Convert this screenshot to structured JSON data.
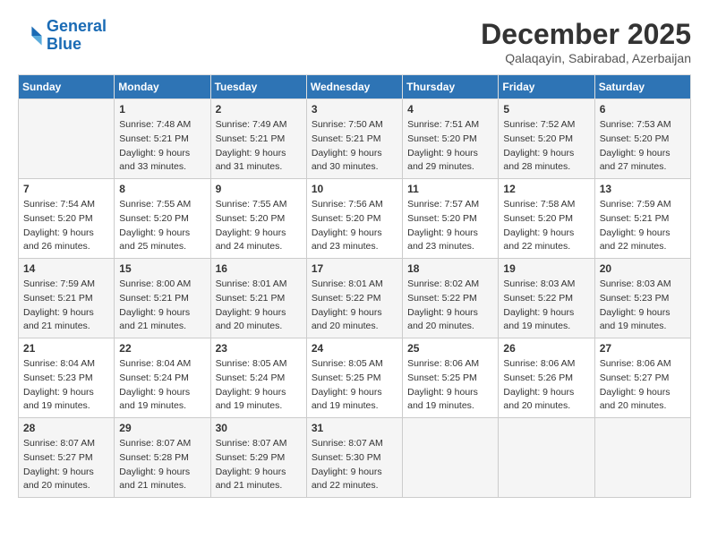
{
  "logo": {
    "line1": "General",
    "line2": "Blue"
  },
  "title": "December 2025",
  "subtitle": "Qalaqayin, Sabirabad, Azerbaijan",
  "weekdays": [
    "Sunday",
    "Monday",
    "Tuesday",
    "Wednesday",
    "Thursday",
    "Friday",
    "Saturday"
  ],
  "weeks": [
    [
      {
        "day": "",
        "sunrise": "",
        "sunset": "",
        "daylight": ""
      },
      {
        "day": "1",
        "sunrise": "Sunrise: 7:48 AM",
        "sunset": "Sunset: 5:21 PM",
        "daylight": "Daylight: 9 hours and 33 minutes."
      },
      {
        "day": "2",
        "sunrise": "Sunrise: 7:49 AM",
        "sunset": "Sunset: 5:21 PM",
        "daylight": "Daylight: 9 hours and 31 minutes."
      },
      {
        "day": "3",
        "sunrise": "Sunrise: 7:50 AM",
        "sunset": "Sunset: 5:21 PM",
        "daylight": "Daylight: 9 hours and 30 minutes."
      },
      {
        "day": "4",
        "sunrise": "Sunrise: 7:51 AM",
        "sunset": "Sunset: 5:20 PM",
        "daylight": "Daylight: 9 hours and 29 minutes."
      },
      {
        "day": "5",
        "sunrise": "Sunrise: 7:52 AM",
        "sunset": "Sunset: 5:20 PM",
        "daylight": "Daylight: 9 hours and 28 minutes."
      },
      {
        "day": "6",
        "sunrise": "Sunrise: 7:53 AM",
        "sunset": "Sunset: 5:20 PM",
        "daylight": "Daylight: 9 hours and 27 minutes."
      }
    ],
    [
      {
        "day": "7",
        "sunrise": "Sunrise: 7:54 AM",
        "sunset": "Sunset: 5:20 PM",
        "daylight": "Daylight: 9 hours and 26 minutes."
      },
      {
        "day": "8",
        "sunrise": "Sunrise: 7:55 AM",
        "sunset": "Sunset: 5:20 PM",
        "daylight": "Daylight: 9 hours and 25 minutes."
      },
      {
        "day": "9",
        "sunrise": "Sunrise: 7:55 AM",
        "sunset": "Sunset: 5:20 PM",
        "daylight": "Daylight: 9 hours and 24 minutes."
      },
      {
        "day": "10",
        "sunrise": "Sunrise: 7:56 AM",
        "sunset": "Sunset: 5:20 PM",
        "daylight": "Daylight: 9 hours and 23 minutes."
      },
      {
        "day": "11",
        "sunrise": "Sunrise: 7:57 AM",
        "sunset": "Sunset: 5:20 PM",
        "daylight": "Daylight: 9 hours and 23 minutes."
      },
      {
        "day": "12",
        "sunrise": "Sunrise: 7:58 AM",
        "sunset": "Sunset: 5:20 PM",
        "daylight": "Daylight: 9 hours and 22 minutes."
      },
      {
        "day": "13",
        "sunrise": "Sunrise: 7:59 AM",
        "sunset": "Sunset: 5:21 PM",
        "daylight": "Daylight: 9 hours and 22 minutes."
      }
    ],
    [
      {
        "day": "14",
        "sunrise": "Sunrise: 7:59 AM",
        "sunset": "Sunset: 5:21 PM",
        "daylight": "Daylight: 9 hours and 21 minutes."
      },
      {
        "day": "15",
        "sunrise": "Sunrise: 8:00 AM",
        "sunset": "Sunset: 5:21 PM",
        "daylight": "Daylight: 9 hours and 21 minutes."
      },
      {
        "day": "16",
        "sunrise": "Sunrise: 8:01 AM",
        "sunset": "Sunset: 5:21 PM",
        "daylight": "Daylight: 9 hours and 20 minutes."
      },
      {
        "day": "17",
        "sunrise": "Sunrise: 8:01 AM",
        "sunset": "Sunset: 5:22 PM",
        "daylight": "Daylight: 9 hours and 20 minutes."
      },
      {
        "day": "18",
        "sunrise": "Sunrise: 8:02 AM",
        "sunset": "Sunset: 5:22 PM",
        "daylight": "Daylight: 9 hours and 20 minutes."
      },
      {
        "day": "19",
        "sunrise": "Sunrise: 8:03 AM",
        "sunset": "Sunset: 5:22 PM",
        "daylight": "Daylight: 9 hours and 19 minutes."
      },
      {
        "day": "20",
        "sunrise": "Sunrise: 8:03 AM",
        "sunset": "Sunset: 5:23 PM",
        "daylight": "Daylight: 9 hours and 19 minutes."
      }
    ],
    [
      {
        "day": "21",
        "sunrise": "Sunrise: 8:04 AM",
        "sunset": "Sunset: 5:23 PM",
        "daylight": "Daylight: 9 hours and 19 minutes."
      },
      {
        "day": "22",
        "sunrise": "Sunrise: 8:04 AM",
        "sunset": "Sunset: 5:24 PM",
        "daylight": "Daylight: 9 hours and 19 minutes."
      },
      {
        "day": "23",
        "sunrise": "Sunrise: 8:05 AM",
        "sunset": "Sunset: 5:24 PM",
        "daylight": "Daylight: 9 hours and 19 minutes."
      },
      {
        "day": "24",
        "sunrise": "Sunrise: 8:05 AM",
        "sunset": "Sunset: 5:25 PM",
        "daylight": "Daylight: 9 hours and 19 minutes."
      },
      {
        "day": "25",
        "sunrise": "Sunrise: 8:06 AM",
        "sunset": "Sunset: 5:25 PM",
        "daylight": "Daylight: 9 hours and 19 minutes."
      },
      {
        "day": "26",
        "sunrise": "Sunrise: 8:06 AM",
        "sunset": "Sunset: 5:26 PM",
        "daylight": "Daylight: 9 hours and 20 minutes."
      },
      {
        "day": "27",
        "sunrise": "Sunrise: 8:06 AM",
        "sunset": "Sunset: 5:27 PM",
        "daylight": "Daylight: 9 hours and 20 minutes."
      }
    ],
    [
      {
        "day": "28",
        "sunrise": "Sunrise: 8:07 AM",
        "sunset": "Sunset: 5:27 PM",
        "daylight": "Daylight: 9 hours and 20 minutes."
      },
      {
        "day": "29",
        "sunrise": "Sunrise: 8:07 AM",
        "sunset": "Sunset: 5:28 PM",
        "daylight": "Daylight: 9 hours and 21 minutes."
      },
      {
        "day": "30",
        "sunrise": "Sunrise: 8:07 AM",
        "sunset": "Sunset: 5:29 PM",
        "daylight": "Daylight: 9 hours and 21 minutes."
      },
      {
        "day": "31",
        "sunrise": "Sunrise: 8:07 AM",
        "sunset": "Sunset: 5:30 PM",
        "daylight": "Daylight: 9 hours and 22 minutes."
      },
      {
        "day": "",
        "sunrise": "",
        "sunset": "",
        "daylight": ""
      },
      {
        "day": "",
        "sunrise": "",
        "sunset": "",
        "daylight": ""
      },
      {
        "day": "",
        "sunrise": "",
        "sunset": "",
        "daylight": ""
      }
    ]
  ]
}
